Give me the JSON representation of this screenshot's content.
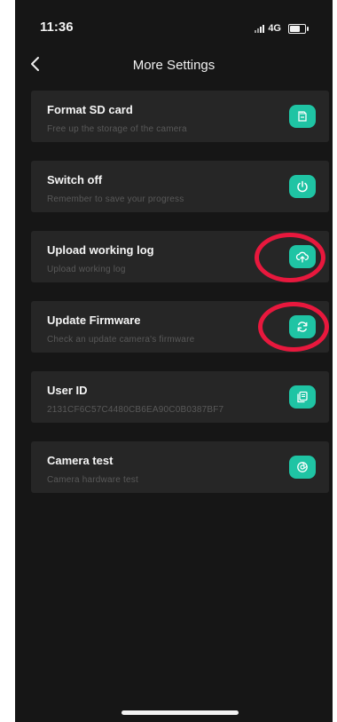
{
  "status_bar": {
    "time": "11:36",
    "network": "4G"
  },
  "header": {
    "title": "More Settings"
  },
  "items": [
    {
      "title": "Format SD card",
      "subtitle": "Free up the storage of the camera",
      "icon": "sd-card-icon"
    },
    {
      "title": "Switch off",
      "subtitle": "Remember to save your progress",
      "icon": "power-icon"
    },
    {
      "title": "Upload working log",
      "subtitle": "Upload working log",
      "icon": "cloud-upload-icon"
    },
    {
      "title": "Update Firmware",
      "subtitle": "Check an update camera's firmware",
      "icon": "refresh-icon"
    },
    {
      "title": "User ID",
      "subtitle": "2131CF6C57C4480CB6EA90C0B0387BF7",
      "icon": "copy-icon"
    },
    {
      "title": "Camera test",
      "subtitle": "Camera hardware test",
      "icon": "camera-test-icon"
    }
  ],
  "colors": {
    "accent": "#1fc4a4",
    "background": "#161616",
    "card": "#262626",
    "highlight_ring": "#e8183d"
  }
}
